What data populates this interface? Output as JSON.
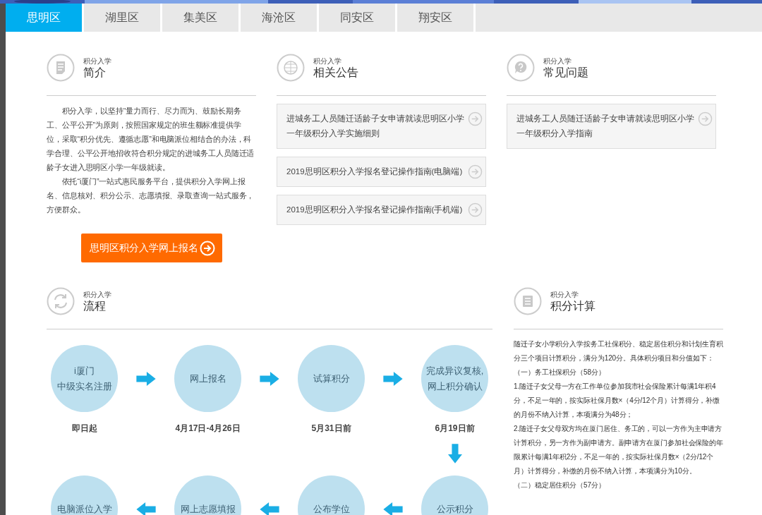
{
  "tabs": [
    {
      "label": "思明区",
      "selected": true
    },
    {
      "label": "湖里区",
      "selected": false
    },
    {
      "label": "集美区",
      "selected": false
    },
    {
      "label": "海沧区",
      "selected": false
    },
    {
      "label": "同安区",
      "selected": false
    },
    {
      "label": "翔安区",
      "selected": false
    }
  ],
  "intro": {
    "kicker": "积分入学",
    "title": "简介",
    "paragraphs": [
      "积分入学，以坚持“量力而行、尽力而为、鼓励长期务工、公平公开”为原则，按照国家规定的班生额标准提供学位，采取“积分优先、遵循志愿”和电脑派位相结合的办法，科学合理、公平公开地招收符合积分规定的进城务工人员随迁适龄子女进入思明区小学一年级就读。",
      "依托“i厦门”一站式惠民服务平台，提供积分入学网上报名、信息核对、积分公示、志愿填报、录取查询一站式服务，方便群众。"
    ],
    "button": "思明区积分入学网上报名"
  },
  "notices": {
    "kicker": "积分入学",
    "title": "相关公告",
    "items": [
      "进城务工人员随迁适龄子女申请就读思明区小学一年级积分入学实施细则",
      "2019思明区积分入学报名登记操作指南(电脑端)",
      "2019思明区积分入学报名登记操作指南(手机端)"
    ]
  },
  "faq": {
    "kicker": "积分入学",
    "title": "常见问题",
    "items": [
      "进城务工人员随迁适龄子女申请就读思明区小学一年级积分入学指南"
    ]
  },
  "flow": {
    "kicker": "积分入学",
    "title": "流程",
    "steps": [
      {
        "lines": [
          "i厦门",
          "中级实名注册"
        ],
        "date": "即日起"
      },
      {
        "lines": [
          "网上报名"
        ],
        "date": "4月17日-4月26日"
      },
      {
        "lines": [
          "试算积分"
        ],
        "date": "5月31日前"
      },
      {
        "lines": [
          "完成异议复核,",
          "网上积分确认"
        ],
        "date": "6月19日前"
      },
      {
        "lines": [
          "电脑派位入学"
        ]
      },
      {
        "lines": [
          "网上志愿填报"
        ]
      },
      {
        "lines": [
          "公布学位"
        ]
      },
      {
        "lines": [
          "公示积分"
        ]
      }
    ]
  },
  "calc": {
    "kicker": "积分入学",
    "title": "积分计算",
    "paragraphs": [
      "随迁子女小学积分入学按务工社保积分、稳定居住积分和计划生育积分三个项目计算积分，满分为120分。具体积分项目和分值如下：",
      "（一）务工社保积分（58分）",
      "1.随迁子女父母一方在工作单位参加我市社会保险累计每满1年积4分，不足一年的，按实际社保月数×（4分/12个月）计算得分，补缴的月份不纳入计算，本项满分为48分；",
      "2.随迁子女父母双方均在厦门居住、务工的，可以一方作为主申请方计算积分，另一方作为副申请方。副申请方在厦门参加社会保险的年限累计每满1年积2分，不足一年的，按实际社保月数×（2分/12个月）计算得分，补缴的月份不纳入计算，本项满分为10分。",
      "（二）稳定居住积分（57分）"
    ]
  }
}
